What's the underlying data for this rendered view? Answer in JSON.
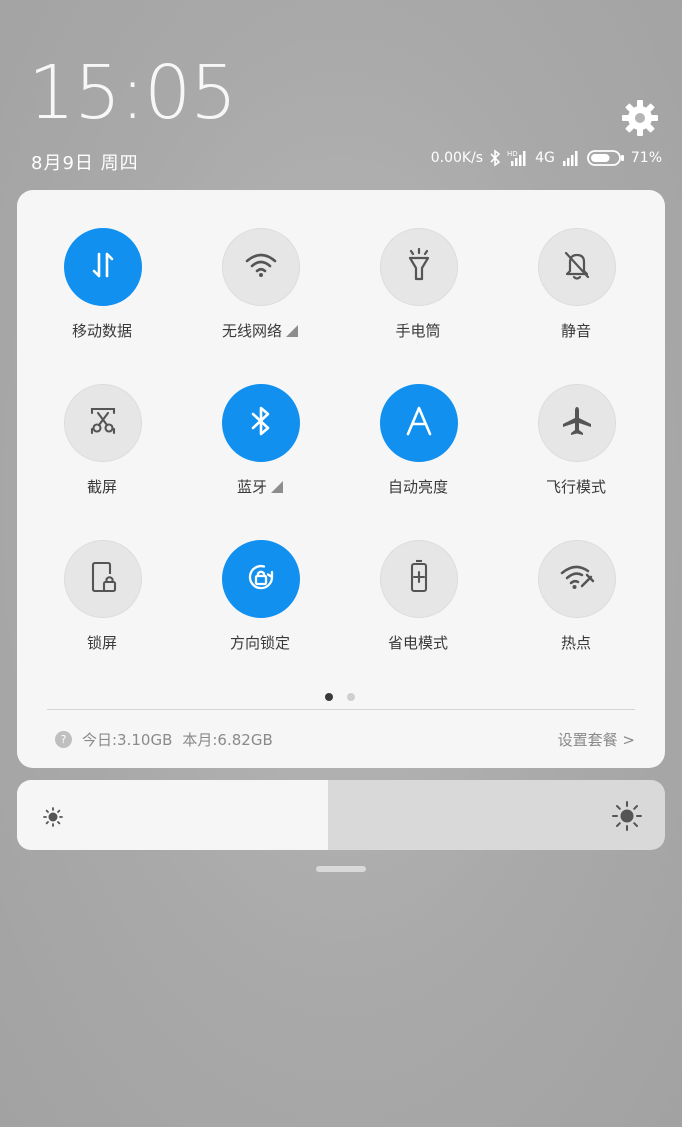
{
  "lockscreen": {
    "time": "15:05",
    "date": "8月9日 周四"
  },
  "status_bar": {
    "net_speed": "0.00K/s",
    "network_type": "4G",
    "battery_percent": "71%",
    "battery_level": 0.71,
    "icons": [
      "bluetooth-icon",
      "hd-signal-icon",
      "4g-signal-icon",
      "battery-icon"
    ]
  },
  "settings": {
    "icon": "gear-icon"
  },
  "toggles": [
    {
      "id": "mobile-data",
      "label": "移动数据",
      "icon": "mobile-data-icon",
      "active": true,
      "has_menu": false
    },
    {
      "id": "wifi",
      "label": "无线网络",
      "icon": "wifi-icon",
      "active": false,
      "has_menu": true
    },
    {
      "id": "flashlight",
      "label": "手电筒",
      "icon": "flashlight-icon",
      "active": false,
      "has_menu": false
    },
    {
      "id": "mute",
      "label": "静音",
      "icon": "bell-off-icon",
      "active": false,
      "has_menu": false
    },
    {
      "id": "screenshot",
      "label": "截屏",
      "icon": "scissors-icon",
      "active": false,
      "has_menu": false
    },
    {
      "id": "bluetooth",
      "label": "蓝牙",
      "icon": "bluetooth-icon",
      "active": true,
      "has_menu": true
    },
    {
      "id": "auto-brightness",
      "label": "自动亮度",
      "icon": "letter-a-icon",
      "active": true,
      "has_menu": false
    },
    {
      "id": "airplane",
      "label": "飞行模式",
      "icon": "airplane-icon",
      "active": false,
      "has_menu": false
    },
    {
      "id": "lock-screen",
      "label": "锁屏",
      "icon": "phone-lock-icon",
      "active": false,
      "has_menu": false
    },
    {
      "id": "rotation-lock",
      "label": "方向锁定",
      "icon": "rotation-lock-icon",
      "active": true,
      "has_menu": false
    },
    {
      "id": "battery-saver",
      "label": "省电模式",
      "icon": "battery-saver-icon",
      "active": false,
      "has_menu": false
    },
    {
      "id": "hotspot",
      "label": "热点",
      "icon": "hotspot-icon",
      "active": false,
      "has_menu": false
    }
  ],
  "pager": {
    "pages": 2,
    "current": 1
  },
  "data_usage": {
    "help_icon": "?",
    "today": "今日:3.10GB",
    "month": "本月:6.82GB",
    "plan_link": "设置套餐 >"
  },
  "brightness": {
    "level": 0.48
  },
  "colors": {
    "accent": "#1190f0",
    "panel": "#f6f6f6",
    "inactive_circle": "#e6e6e6",
    "icon_gray": "#555555"
  }
}
